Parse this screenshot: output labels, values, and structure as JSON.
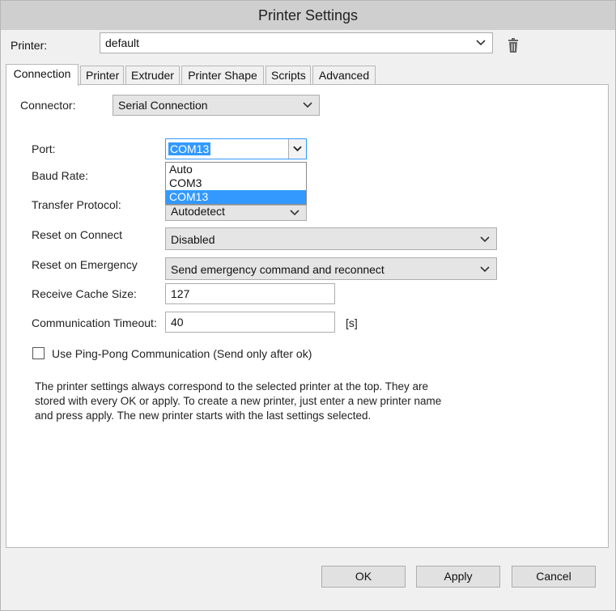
{
  "window": {
    "title": "Printer Settings"
  },
  "printer": {
    "label": "Printer:",
    "value": "default",
    "delete_icon": "trash-icon"
  },
  "tabs": [
    {
      "label": "Connection",
      "active": true
    },
    {
      "label": "Printer"
    },
    {
      "label": "Extruder"
    },
    {
      "label": "Printer Shape"
    },
    {
      "label": "Scripts"
    },
    {
      "label": "Advanced"
    }
  ],
  "connection": {
    "connector_label": "Connector:",
    "connector_value": "Serial Connection",
    "port_label": "Port:",
    "port_value": "COM13",
    "port_options": [
      "Auto",
      "COM3",
      "COM13"
    ],
    "port_selected": "COM13",
    "baud_label": "Baud Rate:",
    "protocol_label": "Transfer Protocol:",
    "protocol_value": "Autodetect",
    "reset_connect_label": "Reset on Connect",
    "reset_connect_value": "Disabled",
    "reset_emergency_label": "Reset on Emergency",
    "reset_emergency_value": "Send emergency command and reconnect",
    "cache_label": "Receive Cache Size:",
    "cache_value": "127",
    "timeout_label": "Communication Timeout:",
    "timeout_value": "40",
    "timeout_unit": "[s]",
    "pingpong_label": "Use Ping-Pong Communication (Send only after ok)",
    "pingpong_checked": false
  },
  "info_text": "The printer settings always correspond to the selected printer at the top. They are stored with every OK or apply. To create a new printer, just enter a new printer name and press apply. The new printer starts with the last settings selected.",
  "buttons": {
    "ok": "OK",
    "apply": "Apply",
    "cancel": "Cancel"
  }
}
